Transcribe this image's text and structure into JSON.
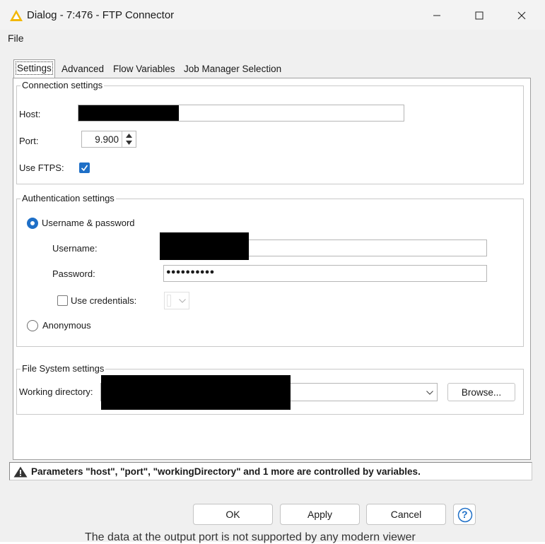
{
  "window": {
    "title": "Dialog - 7:476 - FTP Connector",
    "controls": {
      "minimize": "minimize-icon",
      "maximize": "maximize-icon",
      "close": "close-icon"
    }
  },
  "menu": {
    "file": "File"
  },
  "tabs": [
    {
      "label": "Settings",
      "active": true
    },
    {
      "label": "Advanced",
      "active": false
    },
    {
      "label": "Flow Variables",
      "active": false
    },
    {
      "label": "Job Manager Selection",
      "active": false
    }
  ],
  "connection": {
    "legend": "Connection settings",
    "host_label": "Host:",
    "port_label": "Port:",
    "port_value": "9.900",
    "use_ftps_label": "Use FTPS:",
    "use_ftps_checked": true
  },
  "auth": {
    "legend": "Authentication settings",
    "username_password_label": "Username & password",
    "username_label": "Username:",
    "password_label": "Password:",
    "password_mask": "●●●●●●●●●●",
    "use_credentials_label": "Use credentials:",
    "anonymous_label": "Anonymous"
  },
  "filesystem": {
    "legend": "File System settings",
    "working_dir_label": "Working directory:",
    "browse_label": "Browse..."
  },
  "status": {
    "message": "Parameters \"host\", \"port\", \"workingDirectory\" and 1 more are controlled by variables."
  },
  "footer": {
    "ok": "OK",
    "apply": "Apply",
    "cancel": "Cancel",
    "help": "?"
  },
  "background_text": "The data at the output port is not supported by any modern viewer",
  "colors": {
    "accent": "#1e6fc7",
    "warning_icon": "#f2b705"
  }
}
